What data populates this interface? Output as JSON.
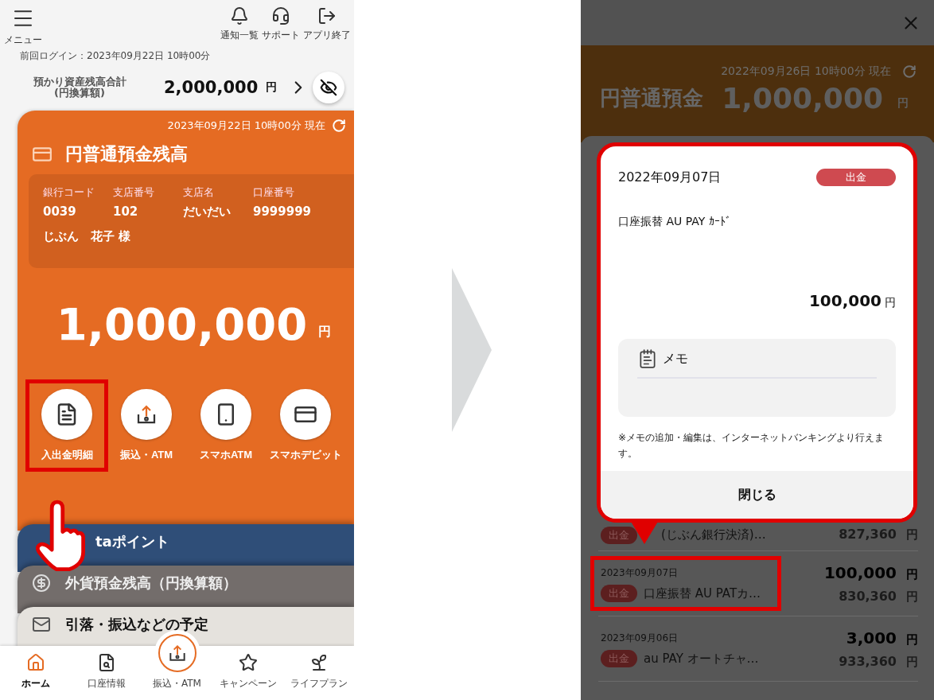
{
  "left_screen": {
    "menu_label": "メニュー",
    "header_actions": [
      {
        "kind": "notifications",
        "label": "通知一覧"
      },
      {
        "kind": "support",
        "label": "サポート"
      },
      {
        "kind": "exit",
        "label": "アプリ終了"
      }
    ],
    "last_login": "前回ログイン：2023年09月22日 10時00分",
    "total_assets": {
      "label_lines": [
        "預かり資産残高合計",
        "(円換算額)"
      ],
      "amount": "2,000,000",
      "unit": "円"
    },
    "balance_card": {
      "timestamp": "2023年09月22日 10時00分 現在",
      "title": "円普通預金残高",
      "account_fields": [
        {
          "label": "銀行コード",
          "value": "0039"
        },
        {
          "label": "支店番号",
          "value": "102"
        },
        {
          "label": "支店名",
          "value": "だいだい"
        },
        {
          "label": "口座番号",
          "value": "9999999"
        }
      ],
      "holder": "じぶん　花子 様",
      "amount": "1,000,000",
      "unit": "円",
      "actions": [
        {
          "kind": "statement",
          "label": "入出金明細",
          "highlighted": true
        },
        {
          "kind": "transfer",
          "label": "振込・ATM",
          "highlighted": false
        },
        {
          "kind": "phone_atm",
          "label": "スマホATM",
          "highlighted": false
        },
        {
          "kind": "debit",
          "label": "スマホデビット",
          "highlighted": false
        }
      ]
    },
    "stacked_cards": [
      {
        "kind": "points",
        "title": "taポイント"
      },
      {
        "kind": "foreign",
        "title": "外貨預金残高（円換算額）"
      },
      {
        "kind": "schedule",
        "title": "引落・振込などの予定"
      }
    ],
    "bottom_nav": [
      {
        "kind": "home",
        "label": "ホーム",
        "selected": true
      },
      {
        "kind": "account",
        "label": "口座情報",
        "selected": false
      },
      {
        "kind": "transfer",
        "label": "振込・ATM",
        "selected": false
      },
      {
        "kind": "campaign",
        "label": "キャンペーン",
        "selected": false
      },
      {
        "kind": "lifeplan",
        "label": "ライフプラン",
        "selected": false
      }
    ]
  },
  "right_screen": {
    "timestamp": "2022年09月26日 10時00分 現在",
    "title": "円普通預金",
    "amount": "1,000,000",
    "unit": "円",
    "modal": {
      "date": "2022年09月07日",
      "badge": "出金",
      "description": "口座振替 AU PAY ｶｰﾄﾞ",
      "amount": "100,000",
      "unit": "円",
      "memo_label": "メモ",
      "note": "※メモの追加・編集は、インターネットバンキングより行えます。",
      "close_button": "閉じる"
    },
    "transactions": [
      {
        "badge": "出金",
        "description": "(じぶん銀行決済)…",
        "balance": "827,360",
        "balance_unit": "円",
        "highlighted": false
      },
      {
        "date": "2023年09月07日",
        "badge": "出金",
        "description": "口座振替 AU PATカ…",
        "amount": "100,000",
        "amount_unit": "円",
        "balance": "830,360",
        "balance_unit": "円",
        "highlighted": true
      },
      {
        "date": "2023年09月06日",
        "badge": "出金",
        "description": "au PAY オートチャ…",
        "amount": "3,000",
        "amount_unit": "円",
        "balance": "933,360",
        "balance_unit": "円",
        "highlighted": false
      }
    ]
  }
}
